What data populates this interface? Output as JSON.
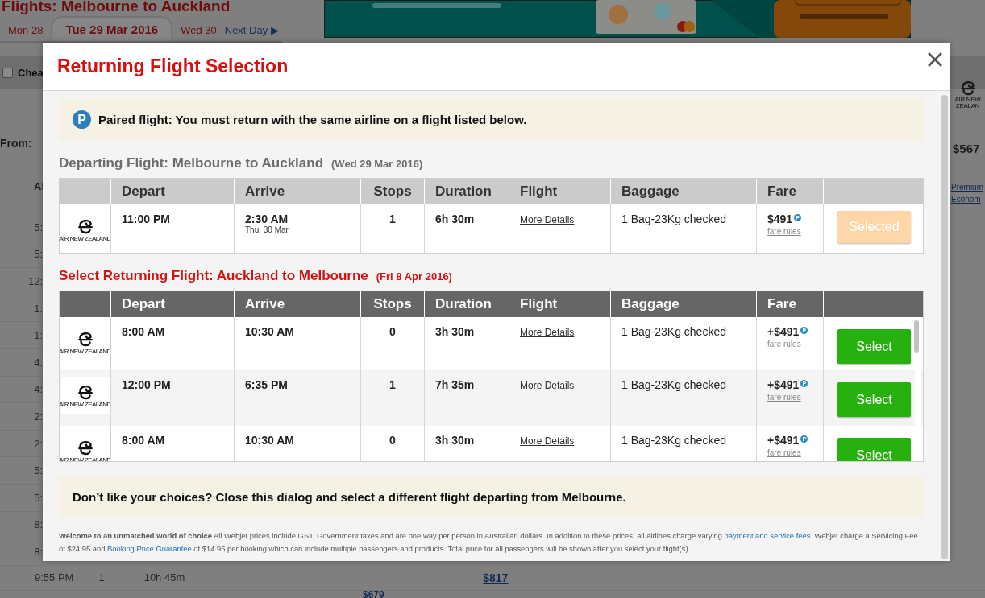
{
  "background": {
    "heading": "Flights: Melbourne to Auckland",
    "date_tabs": [
      {
        "label": "Mon 28",
        "selected": false
      },
      {
        "label": "Tue 29 Mar 2016",
        "selected": true
      },
      {
        "label": "Wed 30",
        "selected": false
      }
    ],
    "next_day": "Next Day ▶",
    "filter": {
      "label": "Chea",
      "checked": false
    },
    "from_label": "From:",
    "column_label": "Al",
    "airline": "AIR NEW ZEALAN",
    "from_price": "$567",
    "cabin_link": "Premium Econom",
    "times": [
      "5:",
      "5:",
      "12:",
      "1:",
      "1:",
      "4:",
      "4:",
      "2:",
      "2:",
      "5:",
      "5:",
      "8:",
      "8:"
    ],
    "last_row": {
      "time": "9:55 PM",
      "stops": "1",
      "duration": "10h 45m",
      "price": "$817"
    },
    "next_price": "$679"
  },
  "dialog": {
    "title": "Returning Flight Selection",
    "notice": {
      "badge": "P",
      "text": "Paired flight: You must return with the same airline on a flight listed below."
    },
    "sections": [
      {
        "kind": "departing",
        "heading": "Departing Flight: Melbourne to Auckland",
        "date": "(Wed 29 Mar 2016)",
        "columns": [
          "Depart",
          "Arrive",
          "Stops",
          "Duration",
          "Flight",
          "Baggage",
          "Fare"
        ],
        "rows": [
          {
            "airline": "AIR NEW ZEALAND",
            "depart": "11:00 PM",
            "arrive": "2:30 AM",
            "arrive_note": "Thu, 30 Mar",
            "stops": "1",
            "duration": "6h 30m",
            "details": "More Details",
            "baggage": "1 Bag-23Kg checked",
            "fare": "$491",
            "fare_badge": "P",
            "fare_rules": "fare rules",
            "action": "Selected",
            "selected": true
          }
        ]
      },
      {
        "kind": "returning",
        "heading": "Select Returning Flight: Auckland to Melbourne",
        "date": "(Fri 8 Apr 2016)",
        "columns": [
          "Depart",
          "Arrive",
          "Stops",
          "Duration",
          "Flight",
          "Baggage",
          "Fare"
        ],
        "rows": [
          {
            "airline": "AIR NEW ZEALAND",
            "depart": "8:00 AM",
            "arrive": "10:30 AM",
            "stops": "0",
            "duration": "3h 30m",
            "details": "More Details",
            "baggage": "1 Bag-23Kg checked",
            "fare": "+$491",
            "fare_badge": "P",
            "fare_rules": "fare rules",
            "action": "Select",
            "selected": false
          },
          {
            "airline": "AIR NEW ZEALAND",
            "depart": "12:00 PM",
            "arrive": "6:35 PM",
            "stops": "1",
            "duration": "7h 35m",
            "details": "More Details",
            "baggage": "1 Bag-23Kg checked",
            "fare": "+$491",
            "fare_badge": "P",
            "fare_rules": "fare rules",
            "action": "Select",
            "selected": false
          },
          {
            "airline": "AIR NEW ZEALAND",
            "depart": "8:00 AM",
            "arrive": "10:30 AM",
            "stops": "0",
            "duration": "3h 30m",
            "details": "More Details",
            "baggage": "1 Bag-23Kg checked",
            "fare": "+$491",
            "fare_badge": "P",
            "fare_rules": "fare rules",
            "action": "Select",
            "selected": false
          }
        ]
      }
    ],
    "footer_notice": "Don’t like your choices? Close this dialog and select a different flight departing from Melbourne.",
    "disclaimer": [
      {
        "kind": "bold",
        "text": "Welcome to an unmatched world of choice"
      },
      {
        "kind": "text",
        "text": " All Webjet prices include GST, Government taxes and are one way per person in Australian dollars. In addition to these prices, all airlines charge varying "
      },
      {
        "kind": "link",
        "text": "payment and service fees"
      },
      {
        "kind": "text",
        "text": ". Webjet charge a Servicing Fee of $24.95 and "
      },
      {
        "kind": "link",
        "text": "Booking Price Guarantee"
      },
      {
        "kind": "text",
        "text": " of $14.95 per booking which can include multiple passengers and products. Total price for all passengers will be shown after you select your flight(s)."
      }
    ]
  }
}
